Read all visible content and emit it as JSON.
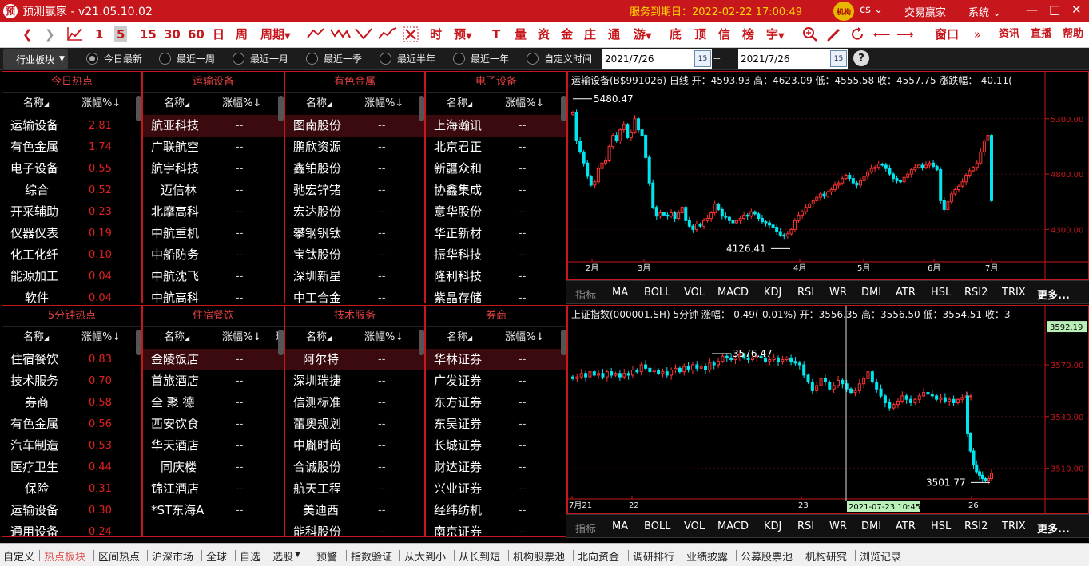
{
  "titlebar": {
    "app_title": "预测赢家 - v21.05.10.02",
    "logo_glyph": "预",
    "service_expiry": "服务到期日：2022-02-22 17:00:49",
    "badge": "机构",
    "user": "cs",
    "menu_trade": "交易赢家",
    "menu_system": "系统"
  },
  "toolbar": {
    "periods": [
      "1",
      "5",
      "15",
      "30",
      "60",
      "日",
      "周",
      "周期"
    ],
    "funcs": [
      "时",
      "预",
      "T",
      "量",
      "资",
      "金",
      "庄",
      "通",
      "游",
      "底",
      "顶",
      "信",
      "榜",
      "宇"
    ],
    "right": [
      "窗口",
      "资讯",
      "直播",
      "帮助"
    ]
  },
  "filterbar": {
    "sector_dropdown": "行业板块",
    "ranges": [
      "今日最新",
      "最近一周",
      "最近一月",
      "最近一季",
      "最近半年",
      "最近一年",
      "自定义时间"
    ],
    "selected": "今日最新",
    "date_from": "2021/7/26",
    "date_to": "2021/7/26",
    "separator": "--",
    "help": "?"
  },
  "table_header": {
    "name_col": "名称",
    "change_col": "涨幅%"
  },
  "panels": [
    {
      "title": "今日热点",
      "rows": [
        {
          "n": "运输设备",
          "v": "2.81"
        },
        {
          "n": "有色金属",
          "v": "1.74"
        },
        {
          "n": "电子设备",
          "v": "0.55"
        },
        {
          "n": "综合",
          "v": "0.52"
        },
        {
          "n": "开采辅助",
          "v": "0.23"
        },
        {
          "n": "仪器仪表",
          "v": "0.19"
        },
        {
          "n": "化工化纤",
          "v": "0.10"
        },
        {
          "n": "能源加工",
          "v": "0.04"
        },
        {
          "n": "软件",
          "v": "0.04"
        }
      ]
    },
    {
      "title": "运输设备",
      "rows": [
        {
          "n": "航亚科技",
          "v": "--"
        },
        {
          "n": "广联航空",
          "v": "--"
        },
        {
          "n": "航宇科技",
          "v": "--"
        },
        {
          "n": "迈信林",
          "v": "--"
        },
        {
          "n": "北摩高科",
          "v": "--"
        },
        {
          "n": "中航重机",
          "v": "--"
        },
        {
          "n": "中船防务",
          "v": "--"
        },
        {
          "n": "中航沈飞",
          "v": "--"
        },
        {
          "n": "中航高科",
          "v": "--"
        }
      ]
    },
    {
      "title": "有色金属",
      "rows": [
        {
          "n": "图南股份",
          "v": "--"
        },
        {
          "n": "鹏欣资源",
          "v": "--"
        },
        {
          "n": "鑫铂股份",
          "v": "--"
        },
        {
          "n": "驰宏锌锗",
          "v": "--"
        },
        {
          "n": "宏达股份",
          "v": "--"
        },
        {
          "n": "攀钢钒钛",
          "v": "--"
        },
        {
          "n": "宝钛股份",
          "v": "--"
        },
        {
          "n": "深圳新星",
          "v": "--"
        },
        {
          "n": "中工合金",
          "v": "--"
        }
      ]
    },
    {
      "title": "电子设备",
      "rows": [
        {
          "n": "上海瀚讯",
          "v": "--"
        },
        {
          "n": "北京君正",
          "v": "--"
        },
        {
          "n": "新疆众和",
          "v": "--"
        },
        {
          "n": "协鑫集成",
          "v": "--"
        },
        {
          "n": "意华股份",
          "v": "--"
        },
        {
          "n": "华正新材",
          "v": "--"
        },
        {
          "n": "振华科技",
          "v": "--"
        },
        {
          "n": "隆利科技",
          "v": "--"
        },
        {
          "n": "紫晶存储",
          "v": "--"
        }
      ]
    },
    {
      "title": "5分钟热点",
      "rows": [
        {
          "n": "住宿餐饮",
          "v": "0.83"
        },
        {
          "n": "技术服务",
          "v": "0.70"
        },
        {
          "n": "券商",
          "v": "0.58"
        },
        {
          "n": "有色金属",
          "v": "0.56"
        },
        {
          "n": "汽车制造",
          "v": "0.53"
        },
        {
          "n": "医疗卫生",
          "v": "0.44"
        },
        {
          "n": "保险",
          "v": "0.31"
        },
        {
          "n": "运输设备",
          "v": "0.30"
        },
        {
          "n": "通用设备",
          "v": "0.24"
        }
      ]
    },
    {
      "title": "住宿餐饮",
      "rows": [
        {
          "n": "金陵饭店",
          "v": "--"
        },
        {
          "n": "首旅酒店",
          "v": "--"
        },
        {
          "n": "全 聚 德",
          "v": "--"
        },
        {
          "n": "西安饮食",
          "v": "--"
        },
        {
          "n": "华天酒店",
          "v": "--"
        },
        {
          "n": "同庆楼",
          "v": "--"
        },
        {
          "n": "锦江酒店",
          "v": "--"
        },
        {
          "n": "*ST东海A",
          "v": "--"
        }
      ]
    },
    {
      "title": "技术服务",
      "rows": [
        {
          "n": "阿尔特",
          "v": "--"
        },
        {
          "n": "深圳瑞捷",
          "v": "--"
        },
        {
          "n": "信测标准",
          "v": "--"
        },
        {
          "n": "蕾奥规划",
          "v": "--"
        },
        {
          "n": "中胤时尚",
          "v": "--"
        },
        {
          "n": "合诚股份",
          "v": "--"
        },
        {
          "n": "航天工程",
          "v": "--"
        },
        {
          "n": "美迪西",
          "v": "--"
        },
        {
          "n": "能科股份",
          "v": "--"
        }
      ]
    },
    {
      "title": "券商",
      "rows": [
        {
          "n": "华林证券",
          "v": "--"
        },
        {
          "n": "广发证券",
          "v": "--"
        },
        {
          "n": "东方证券",
          "v": "--"
        },
        {
          "n": "东吴证券",
          "v": "--"
        },
        {
          "n": "长城证券",
          "v": "--"
        },
        {
          "n": "财达证券",
          "v": "--"
        },
        {
          "n": "兴业证券",
          "v": "--"
        },
        {
          "n": "经纬纺机",
          "v": "--"
        },
        {
          "n": "南京证券",
          "v": "--"
        }
      ]
    }
  ],
  "chart_top": {
    "header": "运输设备(B$991026) 日线 开：4593.93 高：4623.09 低：4555.58 收：4557.75 涨跌幅：-40.11(",
    "high_label": "5480.47",
    "low_label": "4126.41",
    "y_ticks": [
      "5300.00",
      "4800.00",
      "4300.00"
    ],
    "x_ticks": [
      "2月",
      "3月",
      "4月",
      "5月",
      "6月",
      "7月"
    ]
  },
  "chart_bottom": {
    "header": "上证指数(000001.SH) 5分钟 涨幅：-0.49(-0.01%) 开：3556.35 高：3556.50 低：3554.51 收：3",
    "high_label": "3576.47",
    "low_label": "3501.77",
    "last_price": "3592.19",
    "y_ticks": [
      "3570.00",
      "3540.00",
      "3510.00"
    ],
    "x_ticks": [
      "7月21",
      "22",
      "23",
      "26"
    ],
    "cursor_time": "2021-07-23 10:45"
  },
  "indicator_tabs": {
    "label": "指标",
    "tabs": [
      "MA",
      "BOLL",
      "VOL",
      "MACD",
      "KDJ",
      "RSI",
      "WR",
      "DMI",
      "ATR",
      "HSL",
      "RSI2",
      "TRIX",
      "更多..."
    ]
  },
  "bottom_nav": {
    "items": [
      "自定义",
      "热点板块",
      "区间热点",
      "沪深市场",
      "全球",
      "自选",
      "选股",
      "预警",
      "指数验证",
      "从大到小",
      "从长到短",
      "机构股票池",
      "北向资金",
      "调研排行",
      "业绩披露",
      "公募股票池",
      "机构研究",
      "浏览记录"
    ],
    "active": "热点板块"
  },
  "chart_data": [
    {
      "type": "candlestick",
      "title": "运输设备(B$991026) 日线",
      "x_ticks": [
        "2月",
        "3月",
        "4月",
        "5月",
        "6月",
        "7月"
      ],
      "y_ticks": [
        5300,
        4800,
        4300
      ],
      "ylim": [
        4050,
        5580
      ],
      "high": 5480.47,
      "low": 4126.41,
      "close": [
        5360,
        5100,
        5000,
        4900,
        4780,
        4700,
        4730,
        4850,
        4900,
        4920,
        5050,
        5150,
        5100,
        5200,
        5250,
        5130,
        5180,
        5300,
        5200,
        5150,
        4950,
        4720,
        4500,
        4420,
        4450,
        4430,
        4420,
        4450,
        4400,
        4450,
        4500,
        4380,
        4330,
        4300,
        4350,
        4330,
        4380,
        4400,
        4450,
        4530,
        4480,
        4420,
        4410,
        4380,
        4360,
        4380,
        4400,
        4430,
        4420,
        4460,
        4440,
        4400,
        4370,
        4360,
        4340,
        4320,
        4280,
        4250,
        4240,
        4260,
        4300,
        4380,
        4430,
        4460,
        4500,
        4530,
        4560,
        4590,
        4620,
        4600,
        4640,
        4660,
        4700,
        4720,
        4760,
        4790,
        4760,
        4720,
        4700,
        4740,
        4780,
        4820,
        4850,
        4860,
        4890,
        4880,
        4850,
        4800,
        4760,
        4740,
        4730,
        4770,
        4800,
        4840,
        4860,
        4880,
        4860,
        4880,
        4900,
        4870,
        4840,
        4560,
        4480,
        4550,
        4620,
        4660,
        4690,
        4730,
        4790,
        4830,
        4860,
        4900,
        5000,
        5100,
        5150,
        4560
      ]
    },
    {
      "type": "candlestick",
      "title": "上证指数(000001.SH) 5分钟",
      "x_ticks": [
        "7月21",
        "22",
        "23",
        "26"
      ],
      "y_ticks": [
        3570,
        3540,
        3510
      ],
      "ylim": [
        3495,
        3595
      ],
      "high": 3576.47,
      "low": 3501.77,
      "last": 3592.19,
      "close": [
        3562,
        3563,
        3565,
        3563,
        3566,
        3564,
        3565,
        3563,
        3566,
        3564,
        3565,
        3563,
        3565,
        3564,
        3567,
        3566,
        3570,
        3568,
        3566,
        3567,
        3565,
        3566,
        3564,
        3567,
        3568,
        3566,
        3569,
        3567,
        3570,
        3568,
        3569,
        3567,
        3571,
        3570,
        3572,
        3575,
        3574,
        3573,
        3574,
        3576,
        3574,
        3573,
        3574,
        3575,
        3574,
        3572,
        3573,
        3574,
        3572,
        3573,
        3574,
        3572,
        3571,
        3570,
        3564,
        3560,
        3555,
        3558,
        3562,
        3560,
        3556,
        3558,
        3561,
        3559,
        3556,
        3554,
        3555,
        3559,
        3562,
        3566,
        3560,
        3556,
        3552,
        3548,
        3545,
        3547,
        3549,
        3552,
        3550,
        3548,
        3550,
        3552,
        3554,
        3553,
        3552,
        3550,
        3551,
        3549,
        3550,
        3548,
        3550,
        3551,
        3552,
        3552,
        3530,
        3520,
        3512,
        3508,
        3506,
        3504,
        3503,
        3504,
        3507
      ]
    }
  ]
}
